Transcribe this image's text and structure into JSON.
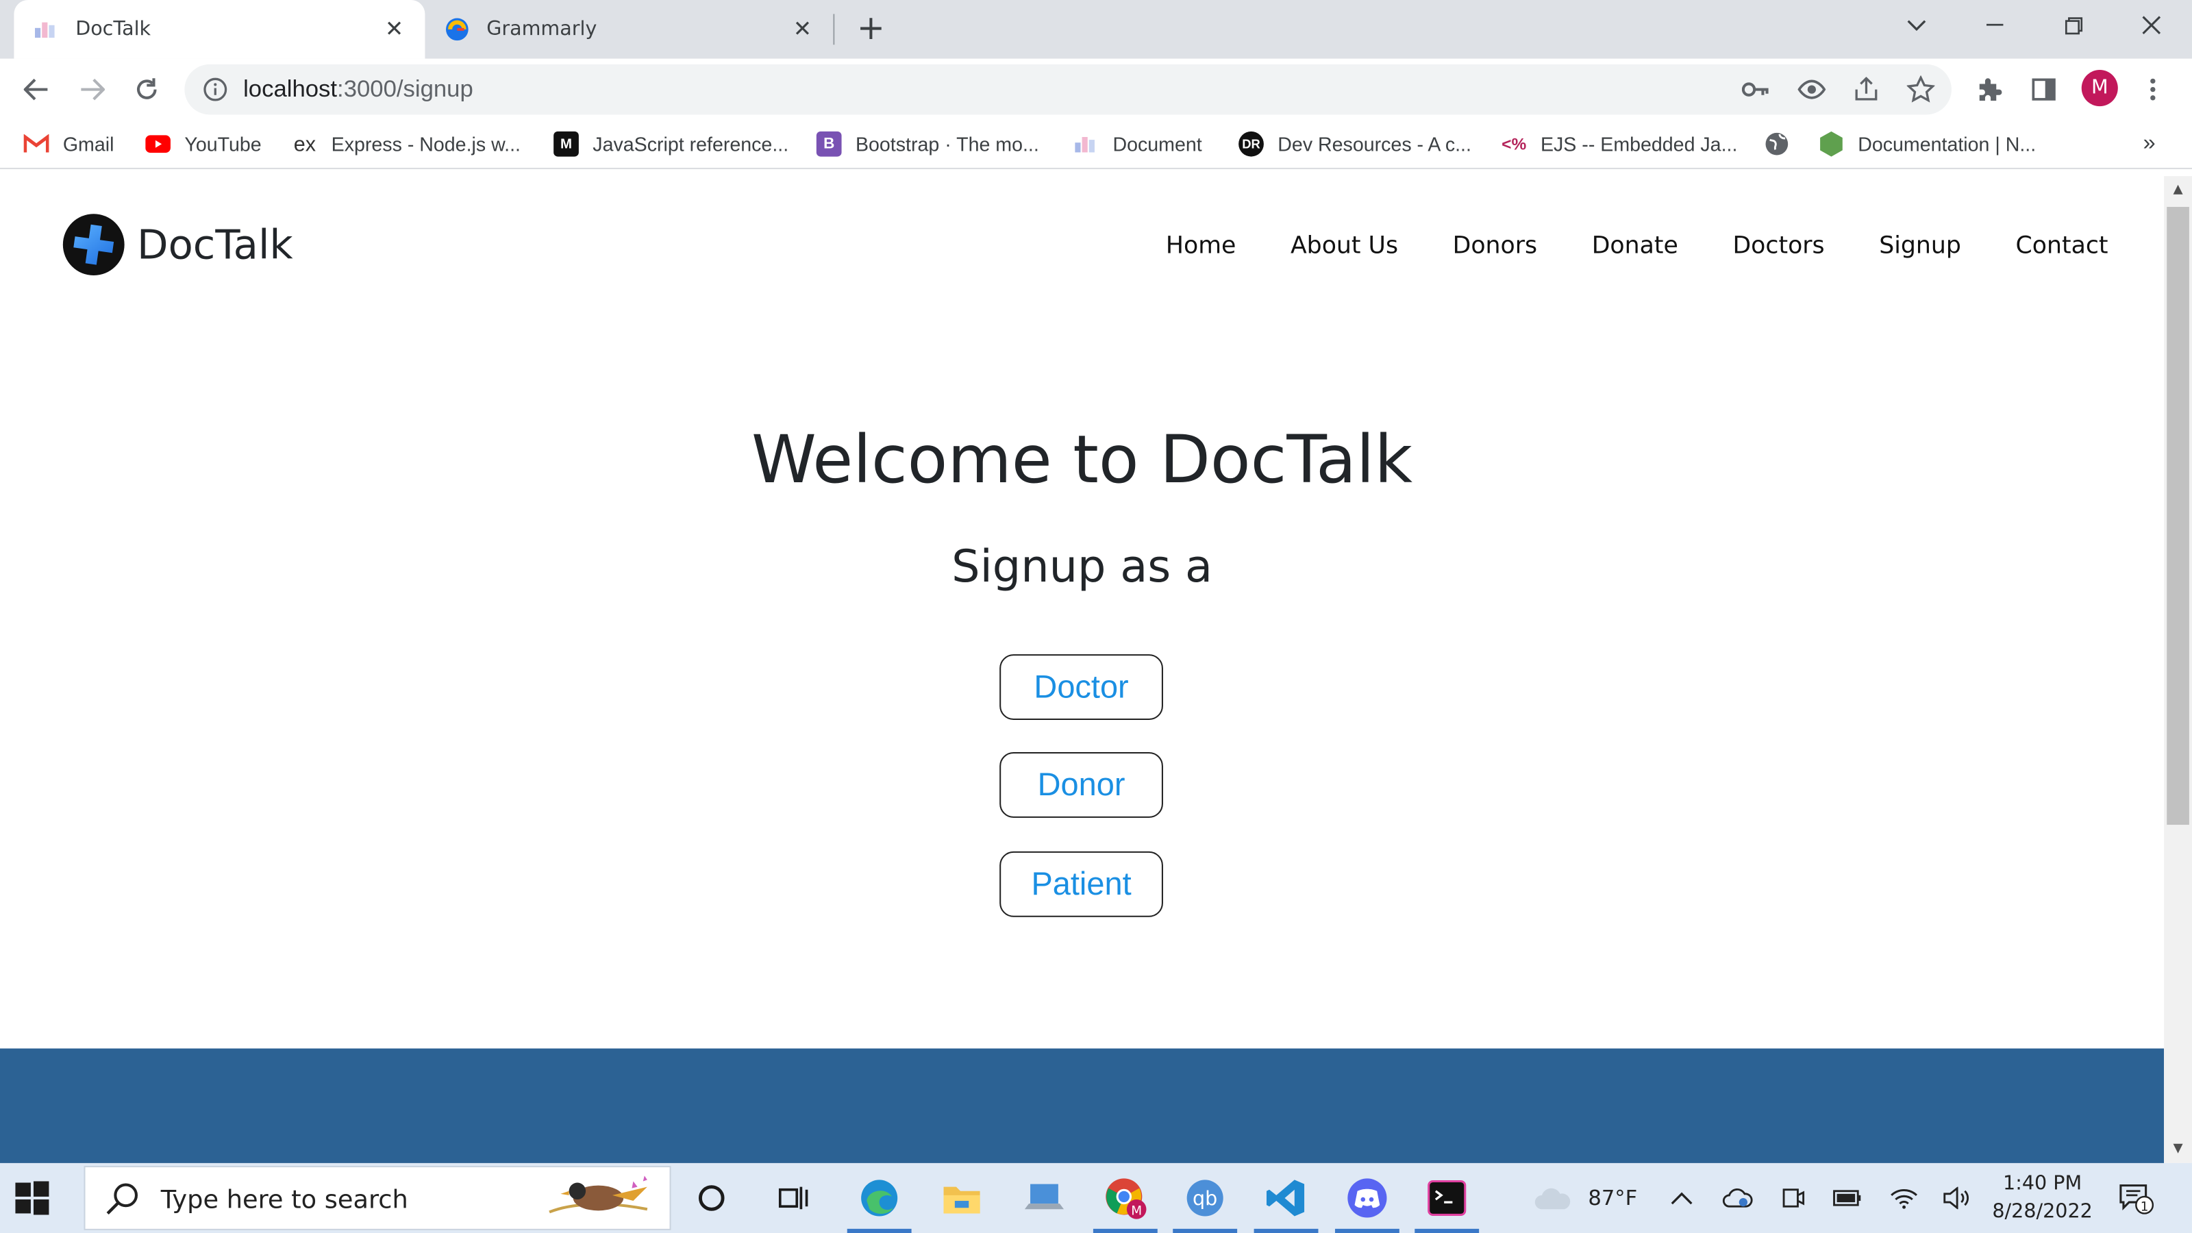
{
  "browser": {
    "tabs": [
      {
        "title": "DocTalk",
        "active": true
      },
      {
        "title": "Grammarly",
        "active": false
      }
    ],
    "url_host": "localhost",
    "url_path": ":3000/signup",
    "profile_initial": "M",
    "bookmarks": [
      {
        "label": "Gmail"
      },
      {
        "label": "YouTube"
      },
      {
        "label": "Express - Node.js w..."
      },
      {
        "label": "JavaScript reference..."
      },
      {
        "label": "Bootstrap · The mo..."
      },
      {
        "label": "Document"
      },
      {
        "label": "Dev Resources - A c..."
      },
      {
        "label": "EJS -- Embedded Ja..."
      },
      {
        "label": "Documentation | N..."
      }
    ],
    "bookmarks_overflow": "»"
  },
  "site": {
    "brand": "DocTalk",
    "nav": [
      "Home",
      "About Us",
      "Donors",
      "Donate",
      "Doctors",
      "Signup",
      "Contact"
    ],
    "hero_title": "Welcome to DocTalk",
    "hero_subtitle": "Signup as a",
    "roles": [
      "Doctor",
      "Donor",
      "Patient"
    ]
  },
  "taskbar": {
    "search_placeholder": "Type here to search",
    "weather": "87°F",
    "time": "1:40 PM",
    "date": "8/28/2022",
    "notification_count": "1"
  },
  "colors": {
    "footer": "#2c6294",
    "link_blue": "#1a8fe3",
    "profile": "#c2185b"
  }
}
